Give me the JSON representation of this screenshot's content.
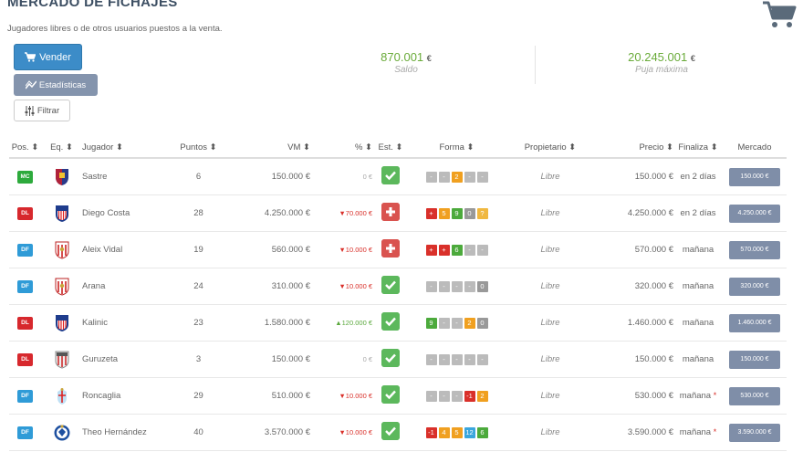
{
  "page": {
    "title": "MERCADO DE FICHAJES",
    "subtitle": "Jugadores libres o de otros usuarios puestos a la venta."
  },
  "toolbar": {
    "sell_label": "Vender",
    "stats_label": "Estadísticas",
    "filter_label": "Filtrar"
  },
  "stats": {
    "saldo_value": "870.001",
    "saldo_currency": "€",
    "saldo_label": "Saldo",
    "puja_value": "20.245.001",
    "puja_currency": "€",
    "puja_label": "Puja máxima"
  },
  "table": {
    "headers": [
      "Pos. ⬍",
      "Eq. ⬍",
      "Jugador ⬍",
      "Puntos ⬍",
      "VM ⬍",
      "% ⬍",
      "Est. ⬍",
      "Forma ⬍",
      "Propietario ⬍",
      "Precio ⬍",
      "Finaliza ⬍",
      "Mercado"
    ],
    "rows": [
      {
        "pos": "MC",
        "team_icon": "huesca-crest",
        "player": "Sastre",
        "points": "6",
        "vm": "150.000 €",
        "pct": "0 €",
        "pct_type": "zero",
        "status": "ok",
        "forma": [
          [
            "-",
            "empty"
          ],
          [
            "-",
            "empty"
          ],
          [
            "2",
            "orange"
          ],
          [
            "-",
            "empty"
          ],
          [
            "-",
            "empty"
          ]
        ],
        "owner": "Libre",
        "price": "150.000 €",
        "ends": "en 2 días",
        "star": false,
        "market": "150.000 €"
      },
      {
        "pos": "DL",
        "team_icon": "atletico-crest",
        "player": "Diego Costa",
        "points": "28",
        "vm": "4.250.000 €",
        "pct": "▼70.000 €",
        "pct_type": "neg",
        "status": "injured",
        "forma": [
          [
            "+",
            "red"
          ],
          [
            "5",
            "orange"
          ],
          [
            "9",
            "green"
          ],
          [
            "0",
            "gray"
          ],
          [
            "?",
            "yellow"
          ]
        ],
        "owner": "Libre",
        "price": "4.250.000 €",
        "ends": "en 2 días",
        "star": false,
        "market": "4.250.000 €"
      },
      {
        "pos": "DF",
        "team_icon": "sevilla-crest",
        "player": "Aleix Vidal",
        "points": "19",
        "vm": "560.000 €",
        "pct": "▼10.000 €",
        "pct_type": "neg",
        "status": "injured",
        "forma": [
          [
            "+",
            "red"
          ],
          [
            "+",
            "red"
          ],
          [
            "6",
            "green"
          ],
          [
            "-",
            "empty"
          ],
          [
            "-",
            "empty"
          ]
        ],
        "owner": "Libre",
        "price": "570.000 €",
        "ends": "mañana",
        "star": false,
        "market": "570.000 €"
      },
      {
        "pos": "DF",
        "team_icon": "sevilla-crest",
        "player": "Arana",
        "points": "24",
        "vm": "310.000 €",
        "pct": "▼10.000 €",
        "pct_type": "neg",
        "status": "ok",
        "forma": [
          [
            "-",
            "empty"
          ],
          [
            "-",
            "empty"
          ],
          [
            "-",
            "empty"
          ],
          [
            "-",
            "empty"
          ],
          [
            "0",
            "gray"
          ]
        ],
        "owner": "Libre",
        "price": "320.000 €",
        "ends": "mañana",
        "star": false,
        "market": "320.000 €"
      },
      {
        "pos": "DL",
        "team_icon": "atletico-crest",
        "player": "Kalinic",
        "points": "23",
        "vm": "1.580.000 €",
        "pct": "▲120.000 €",
        "pct_type": "pos",
        "status": "ok",
        "forma": [
          [
            "9",
            "green"
          ],
          [
            "-",
            "empty"
          ],
          [
            "-",
            "empty"
          ],
          [
            "2",
            "orange"
          ],
          [
            "0",
            "gray"
          ]
        ],
        "owner": "Libre",
        "price": "1.460.000 €",
        "ends": "mañana",
        "star": false,
        "market": "1.460.000 €"
      },
      {
        "pos": "DL",
        "team_icon": "athletic-crest",
        "player": "Guruzeta",
        "points": "3",
        "vm": "150.000 €",
        "pct": "0 €",
        "pct_type": "zero",
        "status": "ok",
        "forma": [
          [
            "-",
            "empty"
          ],
          [
            "-",
            "empty"
          ],
          [
            "-",
            "empty"
          ],
          [
            "-",
            "empty"
          ],
          [
            "-",
            "empty"
          ]
        ],
        "owner": "Libre",
        "price": "150.000 €",
        "ends": "mañana",
        "star": false,
        "market": "150.000 €"
      },
      {
        "pos": "DF",
        "team_icon": "celta-crest",
        "player": "Roncaglia",
        "points": "29",
        "vm": "510.000 €",
        "pct": "▼10.000 €",
        "pct_type": "neg",
        "status": "ok",
        "forma": [
          [
            "-",
            "empty"
          ],
          [
            "-",
            "empty"
          ],
          [
            "-",
            "empty"
          ],
          [
            "-1",
            "red"
          ],
          [
            "2",
            "orange"
          ]
        ],
        "owner": "Libre",
        "price": "530.000 €",
        "ends": "mañana",
        "star": true,
        "market": "530.000 €"
      },
      {
        "pos": "DF",
        "team_icon": "realsociedad-crest",
        "player": "Theo Hernández",
        "points": "40",
        "vm": "3.570.000 €",
        "pct": "▼10.000 €",
        "pct_type": "neg",
        "status": "ok",
        "forma": [
          [
            "-1",
            "red"
          ],
          [
            "4",
            "orange"
          ],
          [
            "5",
            "orange"
          ],
          [
            "12",
            "blue"
          ],
          [
            "6",
            "green"
          ]
        ],
        "owner": "Libre",
        "price": "3.590.000 €",
        "ends": "mañana",
        "star": true,
        "market": "3.590.000 €"
      }
    ]
  },
  "colors": {
    "accent": "#3c8cc8",
    "positive": "#6aab3a",
    "negative": "#d9302a",
    "market_button": "#7f8ea8"
  }
}
